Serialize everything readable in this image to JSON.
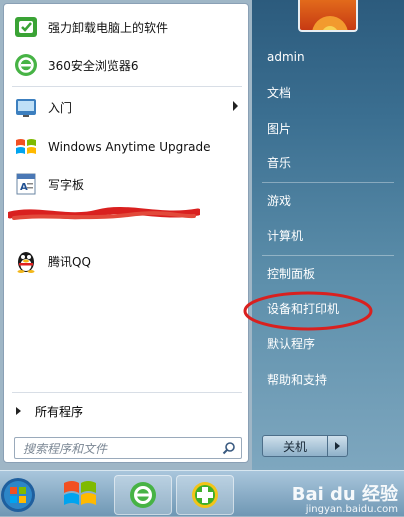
{
  "start_menu": {
    "pinned": [
      {
        "label": "强力卸载电脑上的软件",
        "icon": "uninstaller-icon"
      },
      {
        "label": "360安全浏览器6",
        "icon": "360-browser-icon"
      }
    ],
    "recent": [
      {
        "label": "入门",
        "icon": "getting-started-icon",
        "has_submenu": true
      },
      {
        "label": "Windows Anytime Upgrade",
        "icon": "windows-upgrade-icon"
      },
      {
        "label": "写字板",
        "icon": "wordpad-icon"
      },
      {
        "label": "",
        "icon": "redacted-app-icon"
      },
      {
        "label": "腾讯QQ",
        "icon": "qq-penguin-icon"
      }
    ],
    "all_programs_label": "所有程序",
    "search_placeholder": "搜索程序和文件"
  },
  "right_pane": {
    "user": "admin",
    "items": [
      "文档",
      "图片",
      "音乐",
      "游戏",
      "计算机",
      "控制面板",
      "设备和打印机",
      "默认程序",
      "帮助和支持"
    ],
    "highlighted_item": "设备和打印机"
  },
  "shutdown": {
    "label": "关机"
  },
  "taskbar": {
    "buttons": [
      {
        "icon": "windows-orb-icon"
      },
      {
        "icon": "windows-flag-icon"
      },
      {
        "icon": "360-browser-icon"
      },
      {
        "icon": "360-guard-icon"
      }
    ]
  },
  "watermark": {
    "brand": "Bai du 经验",
    "url": "jingyan.baidu.com"
  },
  "colors": {
    "annotation_red": "#d9201f",
    "menu_right_top": "#2c5b7d",
    "menu_right_bottom": "#7ea7bf"
  }
}
